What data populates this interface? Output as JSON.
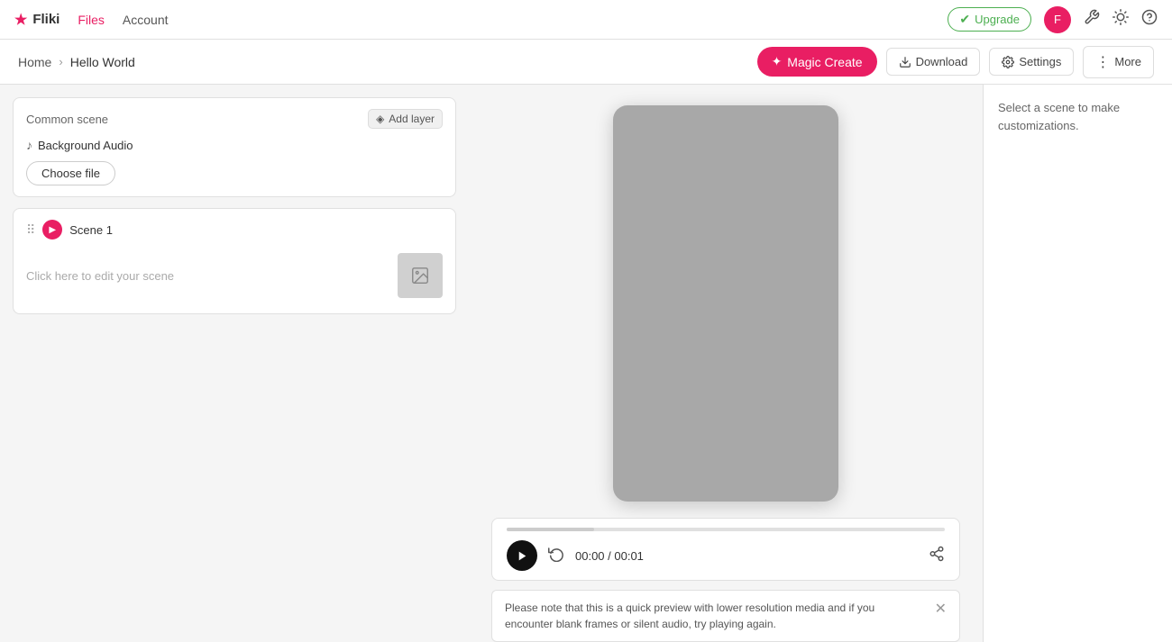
{
  "app": {
    "logo": "Fliki",
    "logo_icon": "★"
  },
  "nav": {
    "files_label": "Files",
    "account_label": "Account",
    "upgrade_label": "Upgrade",
    "upgrade_icon": "✔",
    "avatar_initials": "F",
    "tools_icon": "⚙",
    "theme_icon": "☀",
    "help_icon": "?"
  },
  "breadcrumb": {
    "home_label": "Home",
    "separator": "›",
    "current_label": "Hello World",
    "magic_create_label": "Magic Create",
    "magic_create_icon": "✦",
    "download_label": "Download",
    "download_icon": "⬇",
    "settings_label": "Settings",
    "settings_icon": "⚙",
    "more_label": "More",
    "more_icon": "⋮"
  },
  "left_panel": {
    "common_scene": {
      "title": "Common scene",
      "add_layer_icon": "◈",
      "add_layer_label": "Add layer",
      "audio_icon": "♪",
      "audio_label": "Background Audio",
      "choose_file_label": "Choose file"
    },
    "scene1": {
      "drag_icon": "⠿",
      "scene_label": "Scene 1",
      "placeholder_text": "Click here to edit your scene",
      "thumb_icon": "🖼"
    }
  },
  "player": {
    "time_current": "00:00",
    "time_separator": " / ",
    "time_total": "00:01",
    "time_display": "00:00 / 00:01"
  },
  "info_banner": {
    "text": "Please note that this is a quick preview with lower resolution media and if you encounter blank frames or silent audio, try playing again.",
    "close_icon": "✕"
  },
  "right_panel": {
    "hint_text": "Select a scene to make customizations."
  }
}
